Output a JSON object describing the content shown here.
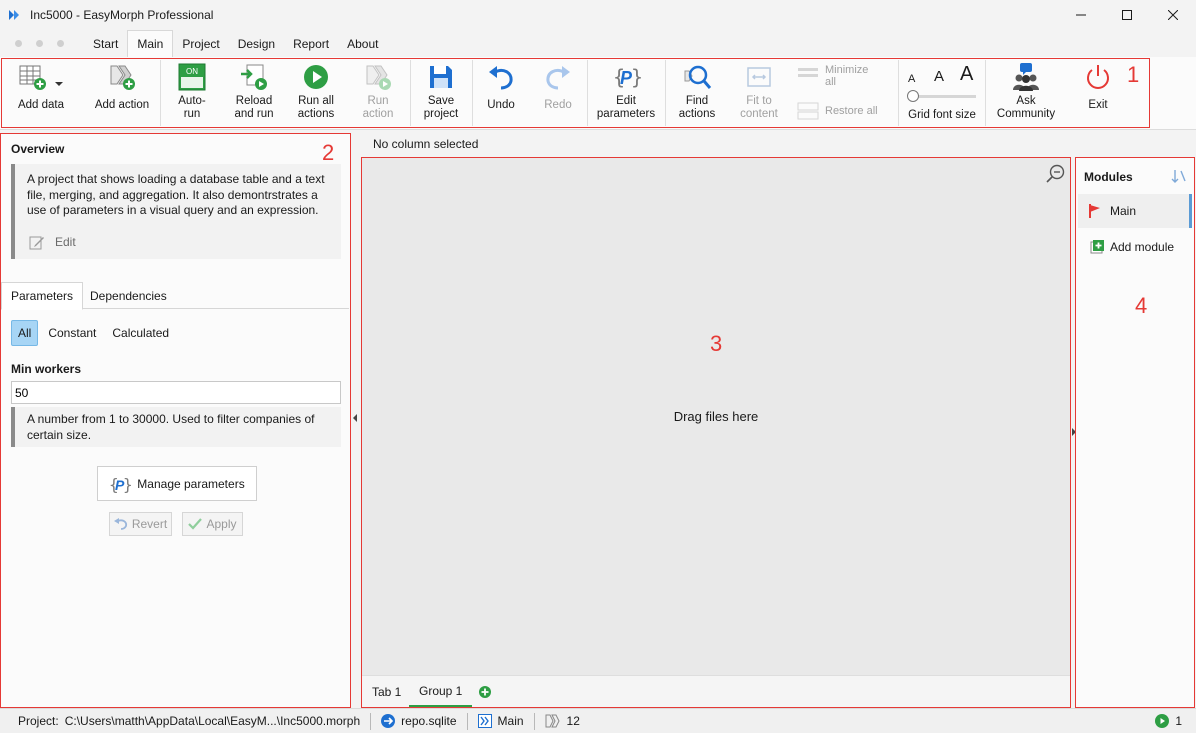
{
  "window": {
    "title": "Inc5000 - EasyMorph Professional"
  },
  "menu": {
    "tabs": [
      "Start",
      "Main",
      "Project",
      "Design",
      "Report",
      "About"
    ],
    "active": "Main"
  },
  "ribbon": {
    "add_data": "Add data",
    "add_action": "Add action",
    "auto_run_1": "Auto-",
    "auto_run_2": "run",
    "auto_run_badge": "ON",
    "reload_1": "Reload",
    "reload_2": "and run",
    "run_all_1": "Run all",
    "run_all_2": "actions",
    "run_action_1": "Run",
    "run_action_2": "action",
    "save_1": "Save",
    "save_2": "project",
    "undo": "Undo",
    "redo": "Redo",
    "edit_params_1": "Edit",
    "edit_params_2": "parameters",
    "find_1": "Find",
    "find_2": "actions",
    "fit_1": "Fit to",
    "fit_2": "content",
    "minimize_1": "Minimize",
    "minimize_2": "all",
    "restore": "Restore all",
    "font_a_small": "A",
    "font_a_mid": "A",
    "font_a_large": "A",
    "grid_font": "Grid font size",
    "ask_1": "Ask",
    "ask_2": "Community",
    "exit": "Exit"
  },
  "annotations": {
    "n1": "1",
    "n2": "2",
    "n3": "3",
    "n4": "4"
  },
  "overview": {
    "title": "Overview",
    "description": "A project that shows loading a database table and a text file, merging, and aggregation. It also demontrstrates a use of parameters in a visual query and an expression.",
    "edit": "Edit"
  },
  "param_tabs": {
    "parameters": "Parameters",
    "dependencies": "Dependencies"
  },
  "filters": {
    "all": "All",
    "constant": "Constant",
    "calculated": "Calculated"
  },
  "parameter": {
    "name": "Min workers",
    "value": "50",
    "description": "A number from 1 to 30000. Used to filter companies of certain size."
  },
  "buttons": {
    "manage": "Manage parameters",
    "revert": "Revert",
    "apply": "Apply"
  },
  "canvas": {
    "column_status": "No column selected",
    "drag_hint": "Drag files here",
    "tabs": [
      "Tab 1",
      "Group 1"
    ]
  },
  "modules": {
    "title": "Modules",
    "items": [
      "Main"
    ],
    "add": "Add module"
  },
  "statusbar": {
    "project_label": "Project:",
    "project_path": "C:\\Users\\matth\\AppData\\Local\\EasyM...\\Inc5000.morph",
    "repo": "repo.sqlite",
    "module": "Main",
    "actions_count": "12",
    "running": "1"
  },
  "colors": {
    "accent_red": "#e53935",
    "green": "#2e9e44",
    "blue": "#1e6fd0",
    "selected_filter": "#a7d5f5"
  }
}
